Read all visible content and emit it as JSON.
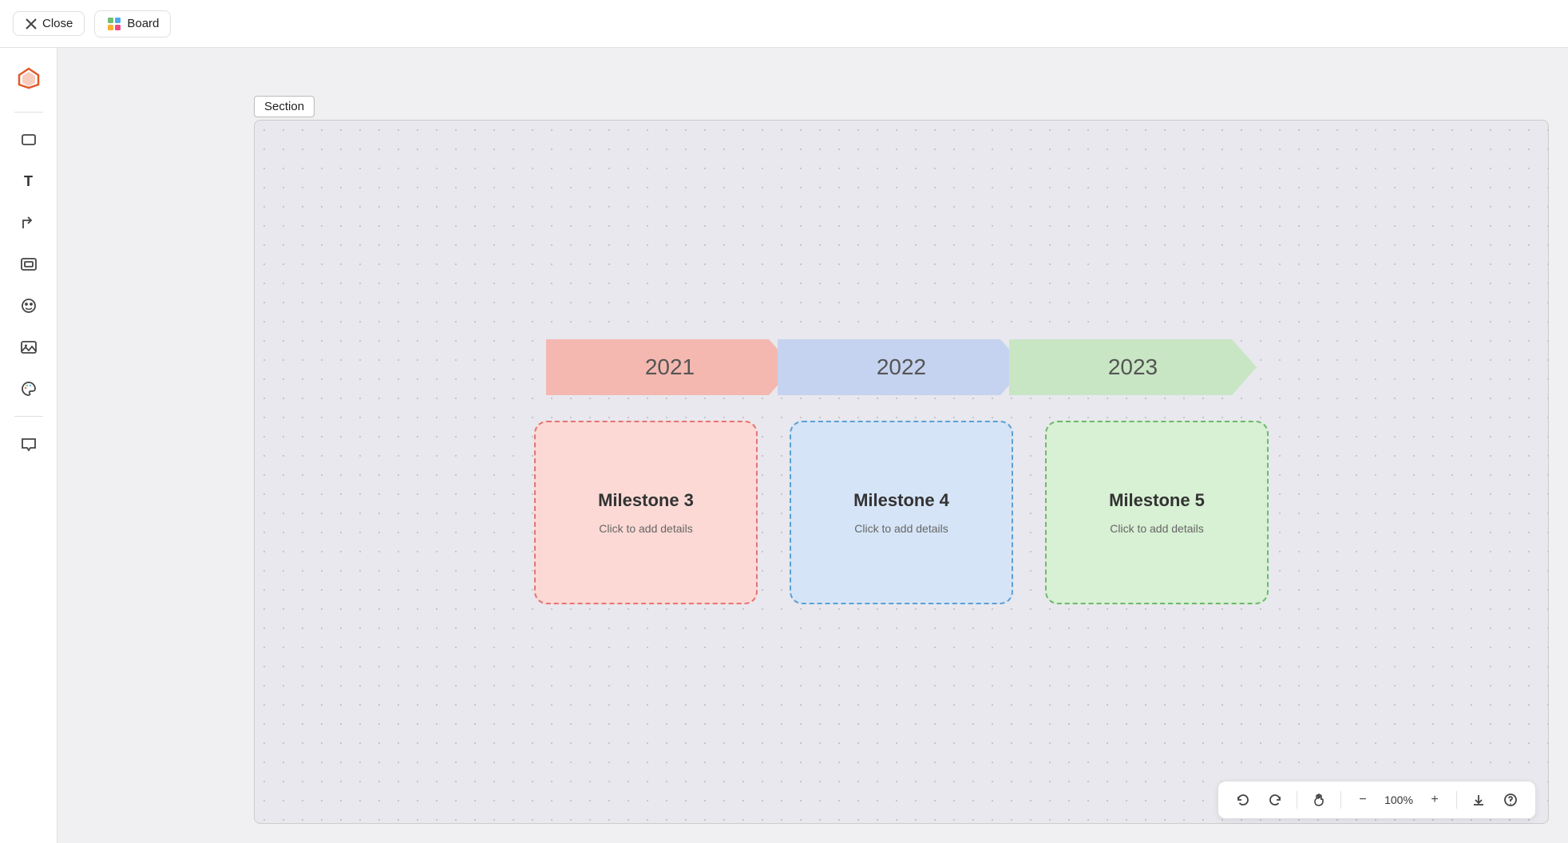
{
  "topBar": {
    "closeLabel": "Close",
    "boardLabel": "Board"
  },
  "toolbar": {
    "items": [
      {
        "name": "logo-icon",
        "symbol": "✦",
        "color": "#e05a2b"
      },
      {
        "name": "rectangle-icon",
        "symbol": "▭"
      },
      {
        "name": "text-icon",
        "symbol": "T"
      },
      {
        "name": "arrow-icon",
        "symbol": "↱"
      },
      {
        "name": "embed-icon",
        "symbol": "⊡"
      },
      {
        "name": "emoji-icon",
        "symbol": "☺"
      },
      {
        "name": "image-icon",
        "symbol": "🖼"
      },
      {
        "name": "palette-icon",
        "symbol": "🎨"
      },
      {
        "name": "comment-icon",
        "symbol": "💬"
      }
    ]
  },
  "section": {
    "label": "Section"
  },
  "arrows": [
    {
      "year": "2021",
      "color": "#f4b8b0"
    },
    {
      "year": "2022",
      "color": "#c5d3f0"
    },
    {
      "year": "2023",
      "color": "#c8e6c4"
    }
  ],
  "milestones": [
    {
      "title": "Milestone 3",
      "subtitle": "Click to add details",
      "theme": "pink"
    },
    {
      "title": "Milestone 4",
      "subtitle": "Click to add details",
      "theme": "blue"
    },
    {
      "title": "Milestone 5",
      "subtitle": "Click to add details",
      "theme": "green"
    }
  ],
  "bottomBar": {
    "undoLabel": "↩",
    "redoLabel": "↪",
    "handLabel": "✋",
    "zoomOutLabel": "−",
    "zoomLevel": "100%",
    "zoomInLabel": "+",
    "downloadLabel": "⬇",
    "helpLabel": "?"
  }
}
